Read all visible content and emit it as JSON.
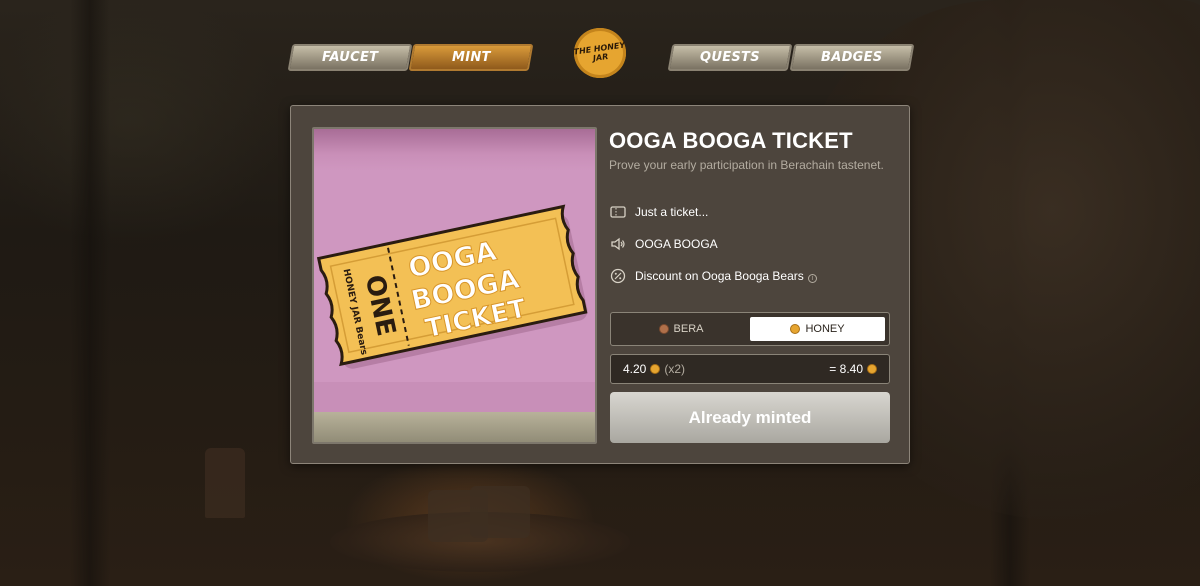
{
  "nav": {
    "items": [
      {
        "label": "FAUCET",
        "active": false
      },
      {
        "label": "MINT",
        "active": true
      },
      {
        "label": "QUESTS",
        "active": false
      },
      {
        "label": "BADGES",
        "active": false
      }
    ],
    "logo_text": "THE HONEY JAR"
  },
  "ticket_image": {
    "line1": "OOGA",
    "line2": "BOOGA",
    "line3": "TICKET",
    "stub_one": "ONE",
    "stub_brand": "HONEY JAR Bears"
  },
  "product": {
    "title": "OOGA BOOGA TICKET",
    "subtitle": "Prove your early participation in Berachain tastenet."
  },
  "features": [
    {
      "icon": "ticket-icon",
      "text": "Just a ticket..."
    },
    {
      "icon": "speaker-icon",
      "text": "OOGA BOOGA"
    },
    {
      "icon": "discount-icon",
      "text": "Discount on Ooga Booga Bears"
    }
  ],
  "currency": {
    "options": [
      {
        "label": "BERA",
        "selected": false
      },
      {
        "label": "HONEY",
        "selected": true
      }
    ]
  },
  "price": {
    "unit": "4.20",
    "multiplier": "(x2)",
    "total": "= 8.40"
  },
  "mint_button": {
    "label": "Already minted"
  },
  "colors": {
    "accent_gold": "#e6a530",
    "card_bg": "#4d453d",
    "ticket_pink": "#cf97c0"
  }
}
